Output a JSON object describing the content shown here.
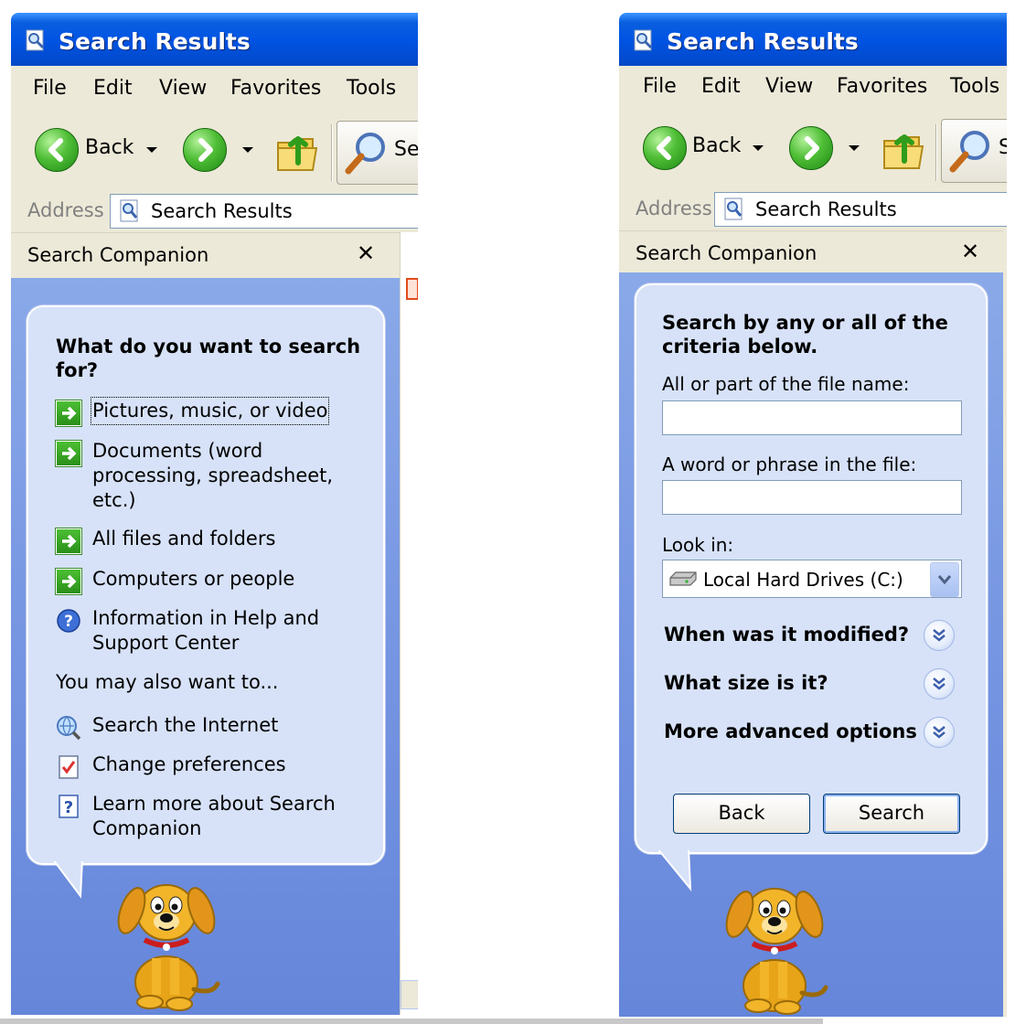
{
  "windows": {
    "left": {
      "title": "Search Results",
      "menu": [
        "File",
        "Edit",
        "View",
        "Favorites",
        "Tools"
      ],
      "toolbar": {
        "back_label": "Back",
        "search_label": "Se"
      },
      "address": {
        "label": "Address",
        "value": "Search Results"
      },
      "pane_title": "Search Companion",
      "close_glyph": "✕",
      "question": "What do you want to search for?",
      "options": [
        {
          "label": "Pictures, music, or video",
          "icon": "green-arrow-icon"
        },
        {
          "label": "Documents (word processing, spreadsheet, etc.)",
          "icon": "green-arrow-icon"
        },
        {
          "label": "All files and folders",
          "icon": "green-arrow-icon"
        },
        {
          "label": "Computers or people",
          "icon": "green-arrow-icon"
        },
        {
          "label": "Information in Help and Support Center",
          "icon": "help-circle-icon"
        }
      ],
      "also_heading": "You may also want to...",
      "also_options": [
        {
          "label": "Search the Internet",
          "icon": "globe-search-icon"
        },
        {
          "label": "Change preferences",
          "icon": "checklist-icon"
        },
        {
          "label": "Learn more about Search Companion",
          "icon": "help-book-icon"
        }
      ]
    },
    "right": {
      "title": "Search Results",
      "menu": [
        "File",
        "Edit",
        "View",
        "Favorites",
        "Tools"
      ],
      "toolbar": {
        "back_label": "Back",
        "search_label": "S"
      },
      "address": {
        "label": "Address",
        "value": "Search Results"
      },
      "pane_title": "Search Companion",
      "close_glyph": "✕",
      "heading": "Search by any or all of the criteria below.",
      "filename_label": "All or part of the file name:",
      "filename_value": "",
      "phrase_label": "A word or phrase in the file:",
      "phrase_value": "",
      "lookin_label": "Look in:",
      "lookin_value": "Local Hard Drives (C:)",
      "sections": [
        "When was it modified?",
        "What size is it?",
        "More advanced options"
      ],
      "back_button": "Back",
      "search_button": "Search"
    }
  },
  "colors": {
    "title_blue": "#0054e3",
    "chrome": "#ece9d8",
    "pane_blue": "#7695e2",
    "bubble": "#d7e2f8"
  }
}
